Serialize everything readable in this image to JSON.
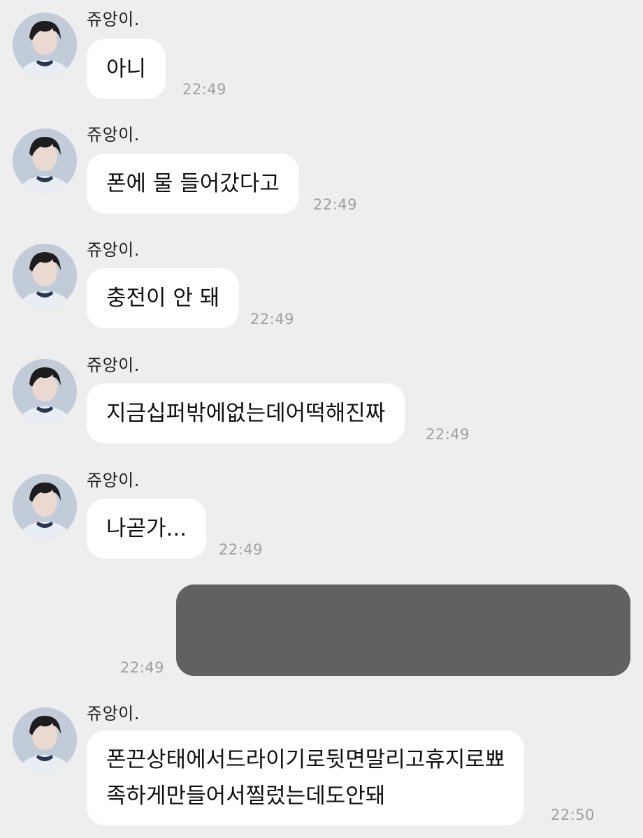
{
  "messages": [
    {
      "sender": "쥬앙이.",
      "text": "아니",
      "time": "22:49"
    },
    {
      "sender": "쥬앙이.",
      "text": "폰에 물 들어갔다고",
      "time": "22:49"
    },
    {
      "sender": "쥬앙이.",
      "text": "충전이 안 돼",
      "time": "22:49"
    },
    {
      "sender": "쥬앙이.",
      "text": "지금십퍼밖에없는데어떡해진짜",
      "time": "22:49"
    },
    {
      "sender": "쥬앙이.",
      "text": "나곧가...",
      "time": "22:49"
    },
    {
      "outgoing": true,
      "time": "22:49",
      "redacted": true
    },
    {
      "sender": "쥬앙이.",
      "lines": [
        "폰끈상태에서드라이기로뒷면말리고휴지로뾰",
        "족하게만들어서찔렀는데도안돼"
      ],
      "time": "22:50"
    }
  ],
  "colors": {
    "background": "#eeeeee",
    "incoming_bubble": "#ffffff",
    "outgoing_bubble_redacted": "#616161",
    "timestamp": "#a0a0a0"
  }
}
